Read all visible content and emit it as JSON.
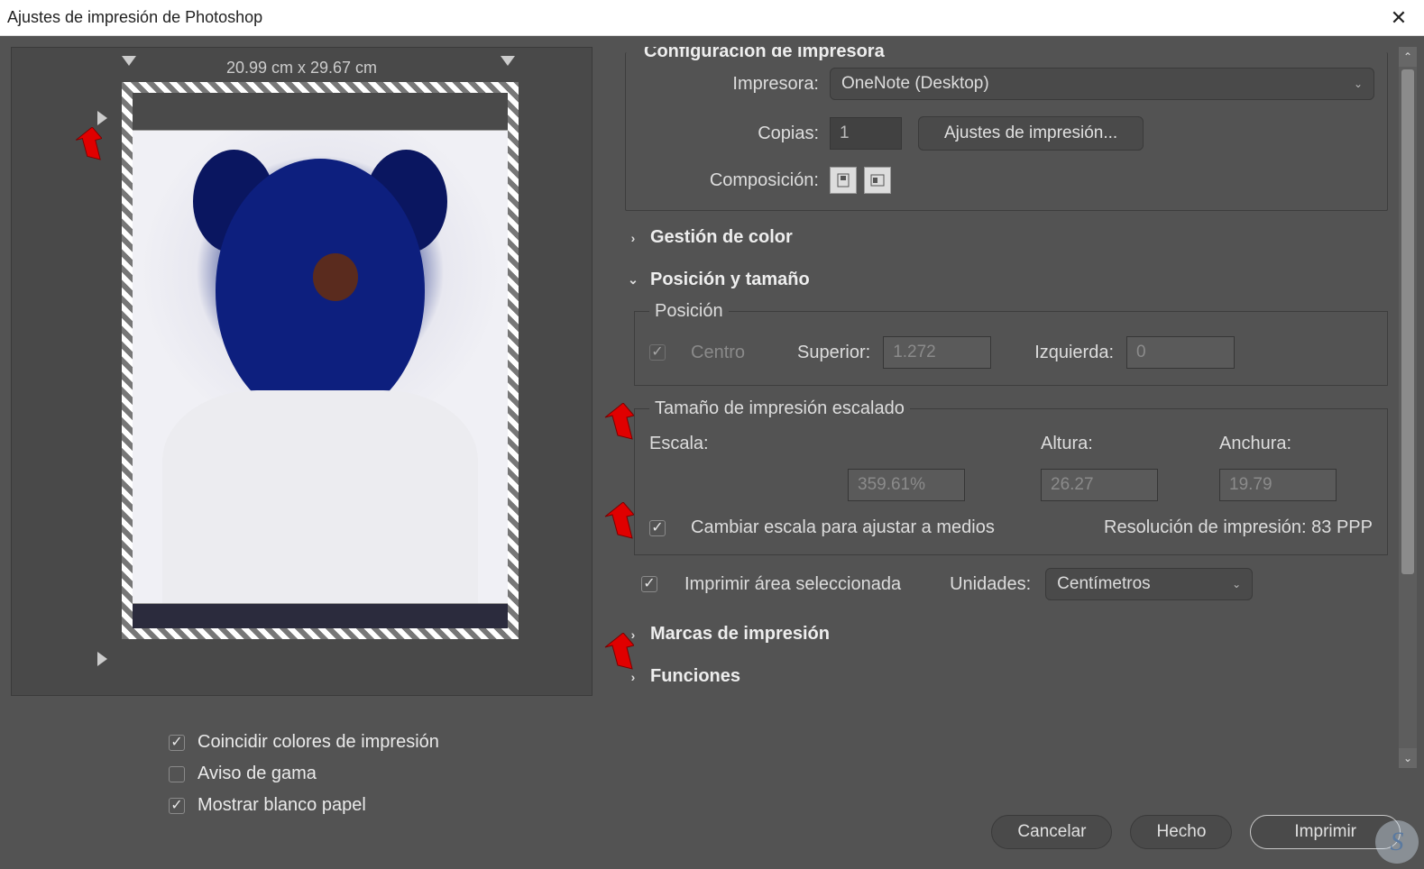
{
  "window": {
    "title": "Ajustes de impresión de Photoshop"
  },
  "preview": {
    "page_dimensions": "20.99 cm x 29.67 cm",
    "check_match": "Coincidir colores de impresión",
    "check_gamut": "Aviso de gama",
    "check_white": "Mostrar blanco papel",
    "match_checked": true,
    "gamut_checked": false,
    "white_checked": true
  },
  "printer_setup": {
    "legend": "Configuración de impresora",
    "printer_label": "Impresora:",
    "printer_value": "OneNote (Desktop)",
    "copies_label": "Copias:",
    "copies_value": "1",
    "settings_button": "Ajustes de impresión...",
    "composition_label": "Composición:"
  },
  "sections": {
    "color_mgmt": "Gestión de color",
    "pos_size": "Posición y tamaño",
    "print_marks": "Marcas de impresión",
    "functions": "Funciones"
  },
  "position": {
    "legend": "Posición",
    "center_label": "Centro",
    "top_label": "Superior:",
    "top_value": "1.272",
    "left_label": "Izquierda:",
    "left_value": "0"
  },
  "scaled": {
    "legend": "Tamaño de impresión escalado",
    "scale_label": "Escala:",
    "scale_value": "359.61%",
    "height_label": "Altura:",
    "height_value": "26.27",
    "width_label": "Anchura:",
    "width_value": "19.79",
    "fit_label": "Cambiar escala para ajustar a medios",
    "resolution_label": "Resolución de impresión: 83 PPP"
  },
  "print_area": {
    "checkbox_label": "Imprimir área seleccionada",
    "units_label": "Unidades:",
    "units_value": "Centímetros"
  },
  "footer": {
    "cancel": "Cancelar",
    "done": "Hecho",
    "print": "Imprimir"
  }
}
